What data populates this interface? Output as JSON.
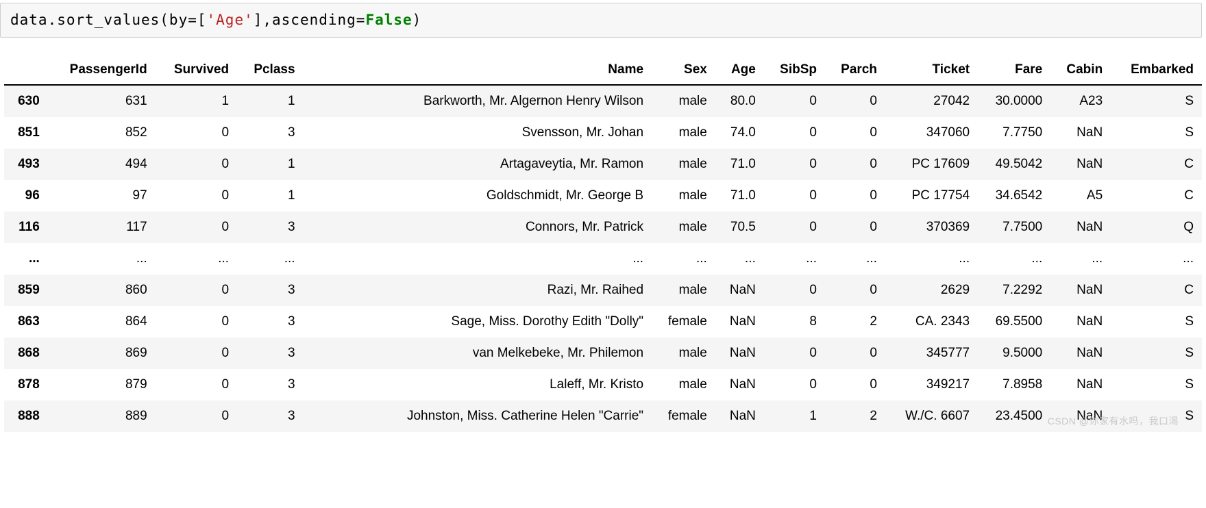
{
  "code": {
    "t0": "data.sort_values(by=[",
    "t1": "'Age'",
    "t2": "],ascending=",
    "t3": "False",
    "t4": ")"
  },
  "table": {
    "index_name": "",
    "columns": [
      "PassengerId",
      "Survived",
      "Pclass",
      "Name",
      "Sex",
      "Age",
      "SibSp",
      "Parch",
      "Ticket",
      "Fare",
      "Cabin",
      "Embarked"
    ],
    "rows": [
      {
        "idx": "630",
        "PassengerId": "631",
        "Survived": "1",
        "Pclass": "1",
        "Name": "Barkworth, Mr. Algernon Henry Wilson",
        "Sex": "male",
        "Age": "80.0",
        "SibSp": "0",
        "Parch": "0",
        "Ticket": "27042",
        "Fare": "30.0000",
        "Cabin": "A23",
        "Embarked": "S"
      },
      {
        "idx": "851",
        "PassengerId": "852",
        "Survived": "0",
        "Pclass": "3",
        "Name": "Svensson, Mr. Johan",
        "Sex": "male",
        "Age": "74.0",
        "SibSp": "0",
        "Parch": "0",
        "Ticket": "347060",
        "Fare": "7.7750",
        "Cabin": "NaN",
        "Embarked": "S"
      },
      {
        "idx": "493",
        "PassengerId": "494",
        "Survived": "0",
        "Pclass": "1",
        "Name": "Artagaveytia, Mr. Ramon",
        "Sex": "male",
        "Age": "71.0",
        "SibSp": "0",
        "Parch": "0",
        "Ticket": "PC 17609",
        "Fare": "49.5042",
        "Cabin": "NaN",
        "Embarked": "C"
      },
      {
        "idx": "96",
        "PassengerId": "97",
        "Survived": "0",
        "Pclass": "1",
        "Name": "Goldschmidt, Mr. George B",
        "Sex": "male",
        "Age": "71.0",
        "SibSp": "0",
        "Parch": "0",
        "Ticket": "PC 17754",
        "Fare": "34.6542",
        "Cabin": "A5",
        "Embarked": "C"
      },
      {
        "idx": "116",
        "PassengerId": "117",
        "Survived": "0",
        "Pclass": "3",
        "Name": "Connors, Mr. Patrick",
        "Sex": "male",
        "Age": "70.5",
        "SibSp": "0",
        "Parch": "0",
        "Ticket": "370369",
        "Fare": "7.7500",
        "Cabin": "NaN",
        "Embarked": "Q"
      },
      {
        "idx": "...",
        "PassengerId": "...",
        "Survived": "...",
        "Pclass": "...",
        "Name": "...",
        "Sex": "...",
        "Age": "...",
        "SibSp": "...",
        "Parch": "...",
        "Ticket": "...",
        "Fare": "...",
        "Cabin": "...",
        "Embarked": "..."
      },
      {
        "idx": "859",
        "PassengerId": "860",
        "Survived": "0",
        "Pclass": "3",
        "Name": "Razi, Mr. Raihed",
        "Sex": "male",
        "Age": "NaN",
        "SibSp": "0",
        "Parch": "0",
        "Ticket": "2629",
        "Fare": "7.2292",
        "Cabin": "NaN",
        "Embarked": "C"
      },
      {
        "idx": "863",
        "PassengerId": "864",
        "Survived": "0",
        "Pclass": "3",
        "Name": "Sage, Miss. Dorothy Edith \"Dolly\"",
        "Sex": "female",
        "Age": "NaN",
        "SibSp": "8",
        "Parch": "2",
        "Ticket": "CA. 2343",
        "Fare": "69.5500",
        "Cabin": "NaN",
        "Embarked": "S"
      },
      {
        "idx": "868",
        "PassengerId": "869",
        "Survived": "0",
        "Pclass": "3",
        "Name": "van Melkebeke, Mr. Philemon",
        "Sex": "male",
        "Age": "NaN",
        "SibSp": "0",
        "Parch": "0",
        "Ticket": "345777",
        "Fare": "9.5000",
        "Cabin": "NaN",
        "Embarked": "S"
      },
      {
        "idx": "878",
        "PassengerId": "879",
        "Survived": "0",
        "Pclass": "3",
        "Name": "Laleff, Mr. Kristo",
        "Sex": "male",
        "Age": "NaN",
        "SibSp": "0",
        "Parch": "0",
        "Ticket": "349217",
        "Fare": "7.8958",
        "Cabin": "NaN",
        "Embarked": "S"
      },
      {
        "idx": "888",
        "PassengerId": "889",
        "Survived": "0",
        "Pclass": "3",
        "Name": "Johnston, Miss. Catherine Helen \"Carrie\"",
        "Sex": "female",
        "Age": "NaN",
        "SibSp": "1",
        "Parch": "2",
        "Ticket": "W./C. 6607",
        "Fare": "23.4500",
        "Cabin": "NaN",
        "Embarked": "S"
      }
    ]
  },
  "watermark": "CSDN @你家有水吗，我口渴"
}
